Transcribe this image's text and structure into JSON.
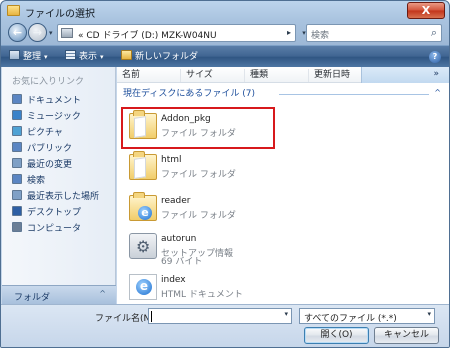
{
  "window": {
    "title": "ファイルの選択",
    "close_glyph": "X"
  },
  "navigation": {
    "back_glyph": "←",
    "forward_glyph": "→",
    "address": "« CD ドライブ (D:) MZK-W04NU",
    "address_arrow": "▸",
    "search_placeholder": "検索"
  },
  "toolbar": {
    "organize": "整理",
    "views": "表示",
    "new_folder": "新しいフォルダ",
    "help": "?"
  },
  "sidebar": {
    "header": "お気に入りリンク",
    "items": [
      {
        "label": "ドキュメント",
        "icon": "documents-icon",
        "color": "#5b86c3"
      },
      {
        "label": "ミュージック",
        "icon": "music-icon",
        "color": "#3a82c9"
      },
      {
        "label": "ピクチャ",
        "icon": "pictures-icon",
        "color": "#4fa2d4"
      },
      {
        "label": "パブリック",
        "icon": "public-icon",
        "color": "#5b86c3"
      },
      {
        "label": "最近の変更",
        "icon": "recent-changes-icon",
        "color": "#7fa0c6"
      },
      {
        "label": "検索",
        "icon": "search-folder-icon",
        "color": "#5b86c3"
      },
      {
        "label": "最近表示した場所",
        "icon": "recent-places-icon",
        "color": "#7fa0c6"
      },
      {
        "label": "デスクトップ",
        "icon": "desktop-icon",
        "color": "#2d5fa4"
      },
      {
        "label": "コンピュータ",
        "icon": "computer-icon",
        "color": "#6a7e96"
      }
    ],
    "folders_label": "フォルダ",
    "folders_chevron": "^"
  },
  "columns": {
    "name": "名前",
    "size": "サイズ",
    "type": "種類",
    "modified": "更新日時",
    "more": "»"
  },
  "group": {
    "label": "現在ディスクにあるファイル (7)",
    "collapse": "^"
  },
  "files": [
    {
      "name": "Addon_pkg",
      "type": "ファイル フォルダ",
      "icon": "folder-icon",
      "selected": true
    },
    {
      "name": "html",
      "type": "ファイル フォルダ",
      "icon": "folder-icon"
    },
    {
      "name": "reader",
      "type": "ファイル フォルダ",
      "icon": "ie-folder-icon"
    },
    {
      "name": "autorun",
      "type": "セットアップ情報",
      "size": "69 バイト",
      "icon": "setup-file-icon"
    },
    {
      "name": "index",
      "type": "HTML ドキュメント",
      "icon": "html-file-icon"
    }
  ],
  "footer": {
    "filename_label": "ファイル名(N):",
    "filename_value": "",
    "filter": "すべてのファイル (*.*)",
    "open_button": "開く(O)",
    "cancel_button": "キャンセル"
  },
  "colors": {
    "selection_outline": "#d7191c",
    "group_text": "#1e4f9c",
    "toolbar": "#3f6491"
  }
}
